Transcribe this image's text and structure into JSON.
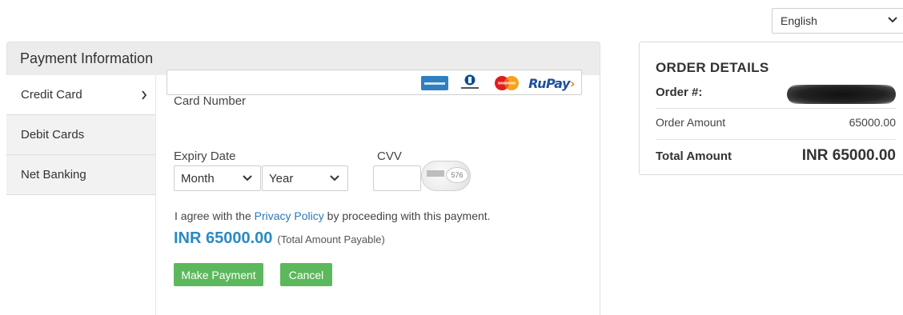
{
  "language": {
    "selected": "English"
  },
  "payment": {
    "header": "Payment Information",
    "tabs": [
      {
        "label": "Credit Card",
        "active": true
      },
      {
        "label": "Debit Cards",
        "active": false
      },
      {
        "label": "Net Banking",
        "active": false
      }
    ],
    "card_number_label": "Card Number",
    "card_number_value": "",
    "card_brands": [
      "American Express",
      "Diners Club",
      "MasterCard",
      "RuPay"
    ],
    "rupay_text": "RuPay",
    "expiry_label": "Expiry Date",
    "month_selected": "Month",
    "year_selected": "Year",
    "cvv_label": "CVV",
    "cvv_value": "",
    "cvv_hint_number": "576",
    "agree_prefix": "I agree with the",
    "privacy_link": "Privacy Policy",
    "agree_suffix": "by proceeding with this payment.",
    "amount_big": "INR 65000.00",
    "amount_note": "(Total Amount Payable)",
    "make_payment_label": "Make Payment",
    "cancel_label": "Cancel"
  },
  "order": {
    "title": "ORDER DETAILS",
    "order_no_label": "Order #:",
    "order_amount_label": "Order Amount",
    "order_amount_value": "65000.00",
    "total_label": "Total Amount",
    "total_value": "INR 65000.00"
  },
  "colors": {
    "accent_green": "#5cb85c",
    "link_blue": "#2a7ab8",
    "amount_blue": "#2a8ac4",
    "header_gray": "#ececec"
  }
}
